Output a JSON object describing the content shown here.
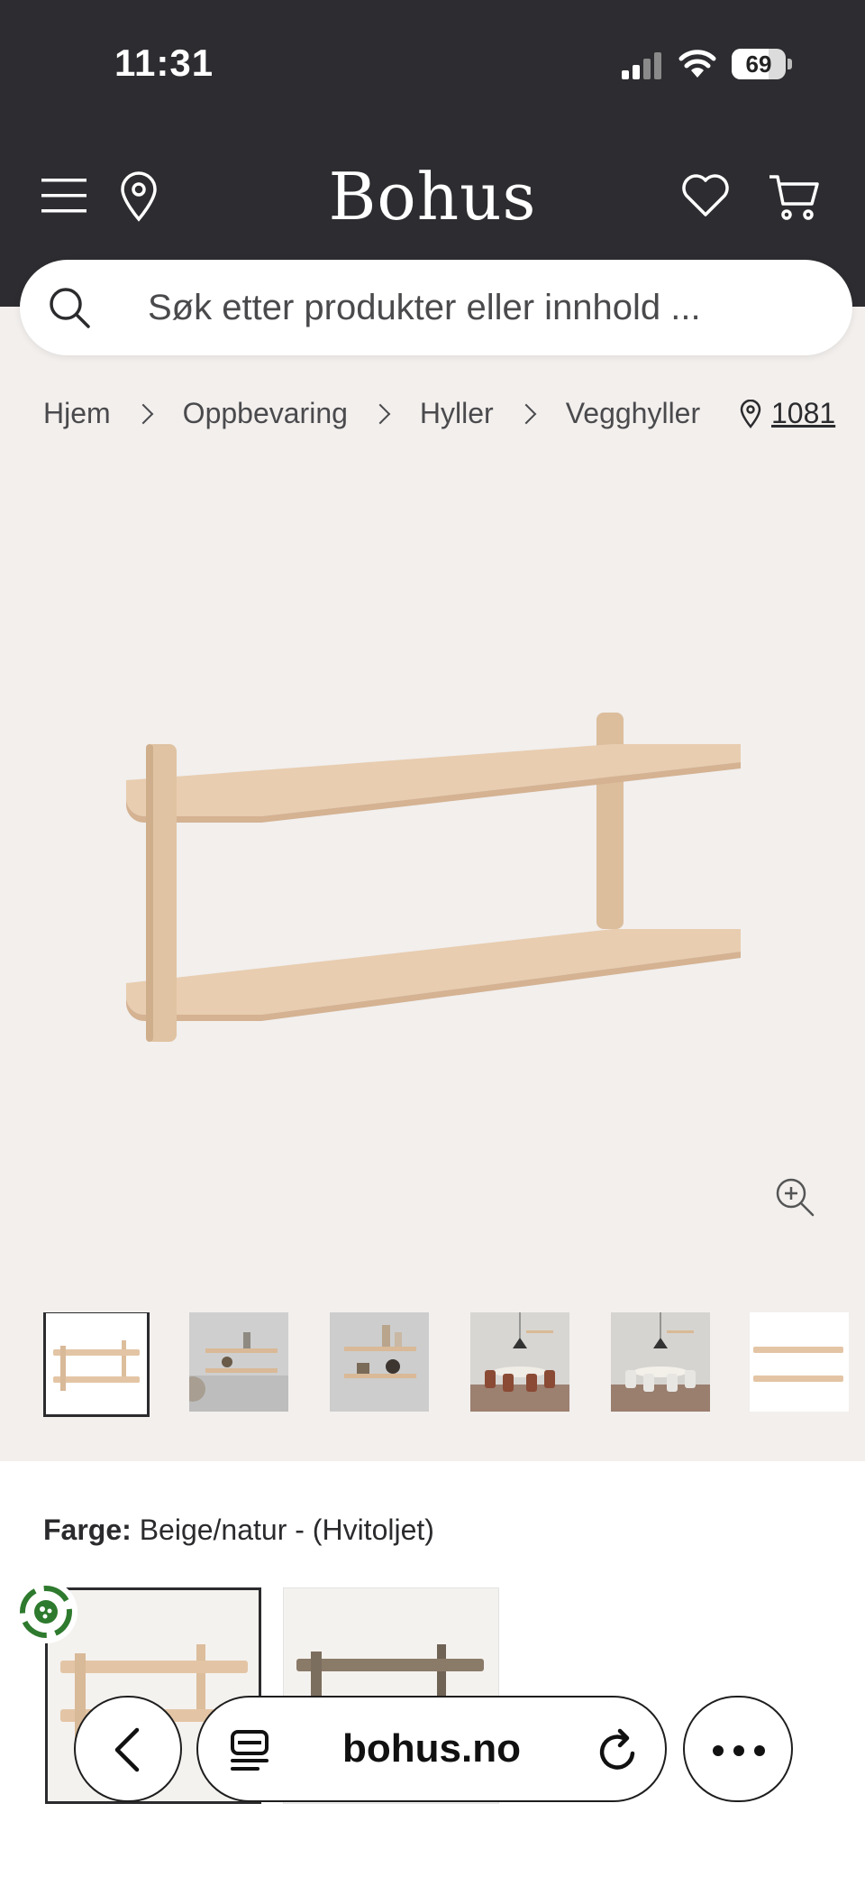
{
  "status_bar": {
    "time": "11:31",
    "battery": "69",
    "battery_level": 0.69
  },
  "header": {
    "logo": "Bohus"
  },
  "search": {
    "placeholder": "Søk etter produkter eller innhold ..."
  },
  "breadcrumb": {
    "items": [
      "Hjem",
      "Oppbevaring",
      "Hyller",
      "Vegghyller"
    ],
    "store_number": "1081"
  },
  "color_select": {
    "label": "Farge:",
    "value": "Beige/natur - (Hvitoljet)"
  },
  "browser": {
    "url": "bohus.no"
  },
  "colors": {
    "topbar": "#2d2c30",
    "page_bg": "#f2efed",
    "wood": "#e6c9aa",
    "wood_dark": "#8a7a68"
  },
  "icons": [
    "menu-icon",
    "location-pin-icon",
    "heart-icon",
    "cart-icon",
    "search-icon",
    "zoom-in-icon",
    "back-icon",
    "reader-icon",
    "reload-icon",
    "more-icon",
    "eco-icon"
  ]
}
